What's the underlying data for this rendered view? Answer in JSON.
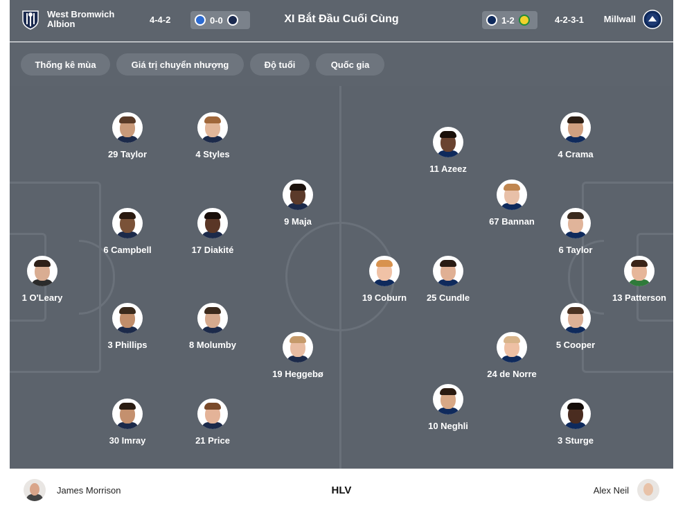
{
  "header": {
    "home_team": "West Bromwich Albion",
    "home_formation": "4-4-2",
    "home_score": "0-0",
    "title": "XI Bắt Đầu Cuối Cùng",
    "away_score": "1-2",
    "away_formation": "4-2-3-1",
    "away_team": "Millwall"
  },
  "tabs": [
    {
      "label": "Thống kê mùa"
    },
    {
      "label": "Giá trị chuyển nhượng"
    },
    {
      "label": "Độ tuổi"
    },
    {
      "label": "Quốc gia"
    }
  ],
  "home_players": [
    {
      "label": "29 Taylor",
      "skin": "#c99a7a",
      "hair": "#5a3b28",
      "shirt": "#1c2a4a"
    },
    {
      "label": "4 Styles",
      "skin": "#e2b79a",
      "hair": "#a0673a",
      "shirt": "#1c2a4a"
    },
    {
      "label": "9 Maja",
      "skin": "#5b3a2a",
      "hair": "#1c120c",
      "shirt": "#1c2a4a"
    },
    {
      "label": "6 Campbell",
      "skin": "#7a5238",
      "hair": "#2a1a10",
      "shirt": "#1c2a4a"
    },
    {
      "label": "17 Diakité",
      "skin": "#5a3626",
      "hair": "#1a0f0a",
      "shirt": "#1c2a4a"
    },
    {
      "label": "1 O'Leary",
      "skin": "#d9ad92",
      "hair": "#2e2018",
      "shirt": "#2b2b2b"
    },
    {
      "label": "3 Phillips",
      "skin": "#c08d6a",
      "hair": "#3a2a1c",
      "shirt": "#1c2a4a"
    },
    {
      "label": "8 Molumby",
      "skin": "#d6aa8e",
      "hair": "#3c2a1c",
      "shirt": "#1c2a4a"
    },
    {
      "label": "19 Heggebø",
      "skin": "#e8bca2",
      "hair": "#c59a6a",
      "shirt": "#1c2a4a"
    },
    {
      "label": "30 Imray",
      "skin": "#c4906e",
      "hair": "#2a1c12",
      "shirt": "#1c2a4a"
    },
    {
      "label": "21 Price",
      "skin": "#e4b398",
      "hair": "#7a4a2a",
      "shirt": "#1c2a4a"
    }
  ],
  "away_players": [
    {
      "label": "11 Azeez",
      "skin": "#6a4330",
      "hair": "#1a100a",
      "shirt": "#0f2a5c"
    },
    {
      "label": "4 Crama",
      "skin": "#d0a080",
      "hair": "#2c1e14",
      "shirt": "#0f2a5c"
    },
    {
      "label": "67 Bannan",
      "skin": "#e8c0a8",
      "hair": "#c08650",
      "shirt": "#0f2a5c"
    },
    {
      "label": "6 Taylor",
      "skin": "#e0b49a",
      "hair": "#3a2a1e",
      "shirt": "#0f2a5c"
    },
    {
      "label": "19 Coburn",
      "skin": "#f0c2a6",
      "hair": "#d8924e",
      "shirt": "#0f2a5c"
    },
    {
      "label": "25 Cundle",
      "skin": "#e0b094",
      "hair": "#2a1c14",
      "shirt": "#0f2a5c"
    },
    {
      "label": "13 Patterson",
      "skin": "#e6b69a",
      "hair": "#3a2418",
      "shirt": "#2f7a3a"
    },
    {
      "label": "5 Cooper",
      "skin": "#dcb096",
      "hair": "#4a3222",
      "shirt": "#0f2a5c"
    },
    {
      "label": "24 de Norre",
      "skin": "#eec0a4",
      "hair": "#d8b48a",
      "shirt": "#0f2a5c"
    },
    {
      "label": "10 Neghli",
      "skin": "#d8a886",
      "hair": "#2a1a10",
      "shirt": "#0f2a5c"
    },
    {
      "label": "3 Sturge",
      "skin": "#4a2c20",
      "hair": "#140c08",
      "shirt": "#0f2a5c"
    }
  ],
  "coaches": {
    "home": "James Morrison",
    "label": "HLV",
    "away": "Alex Neil"
  },
  "colors": {
    "pitch": "#5c636c",
    "header": "#5d646d",
    "lines": "#6a717a"
  }
}
